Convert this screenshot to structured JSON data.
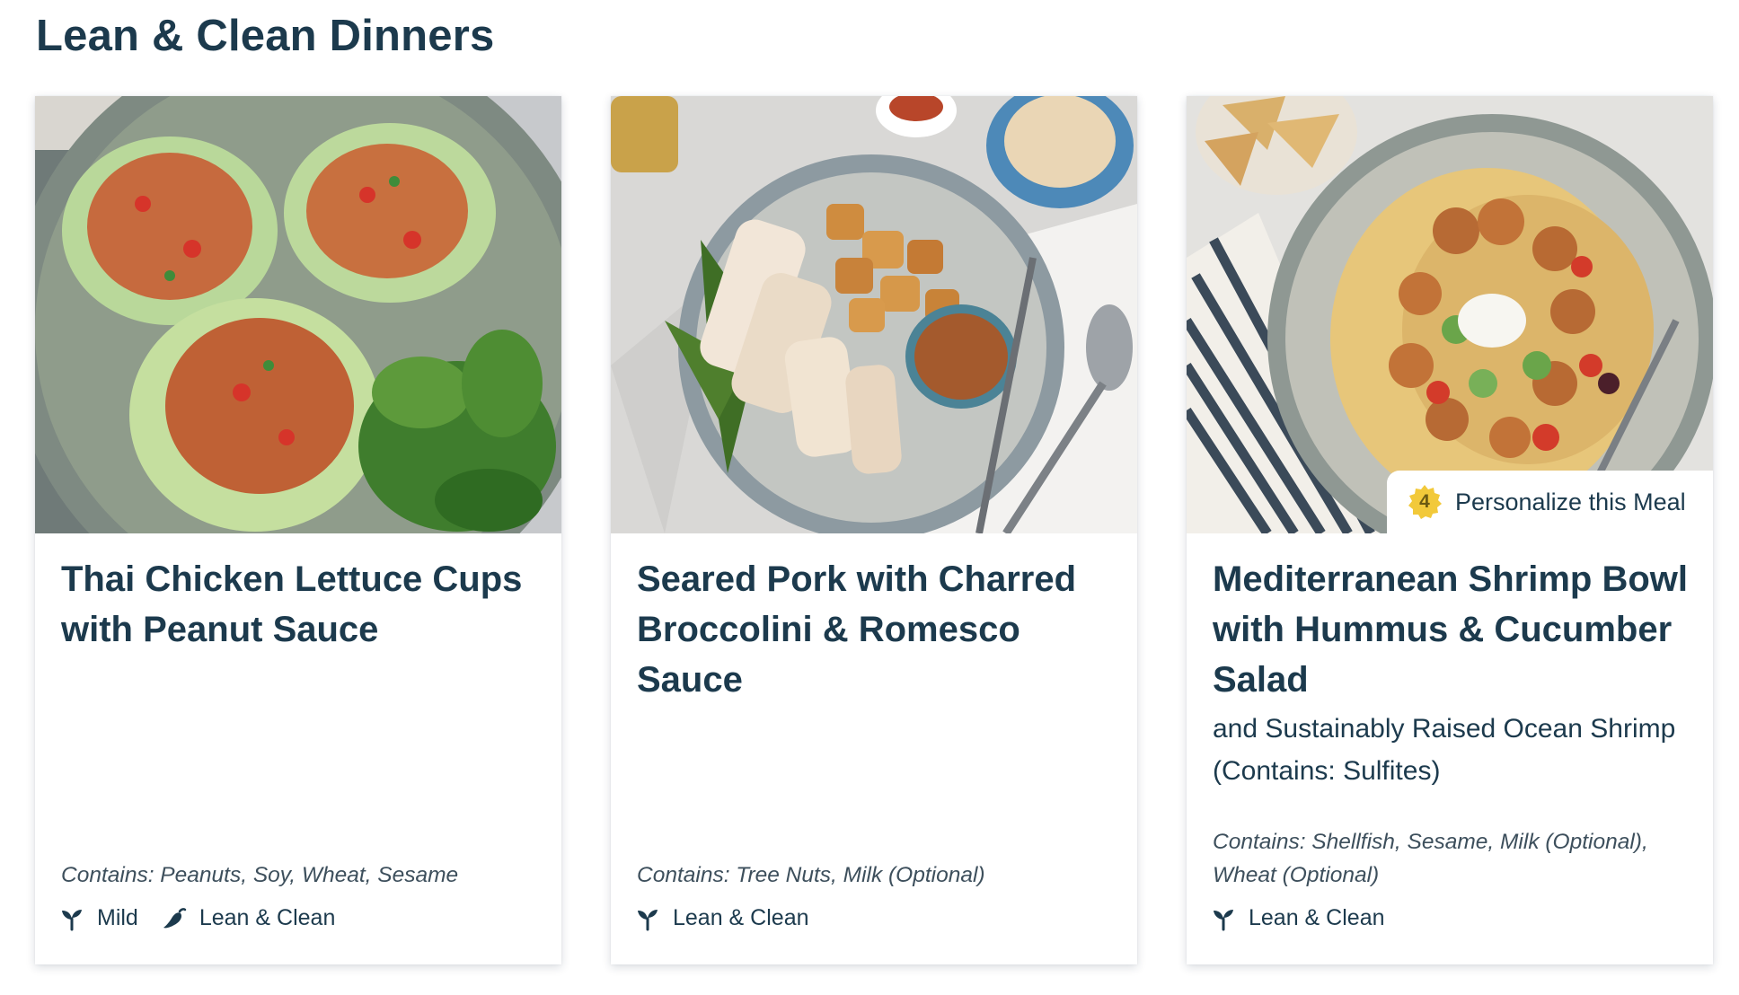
{
  "section": {
    "title": "Lean & Clean Dinners"
  },
  "cards": [
    {
      "image_alt": "Thai chicken lettuce cups on a plate with fresh herbs",
      "title": "Thai Chicken Lettuce Cups with Peanut Sauce",
      "subtitle": "",
      "allergens": "Contains: Peanuts, Soy, Wheat, Sesame",
      "tags": [
        {
          "label": "Mild",
          "icon": "sprout-icon"
        },
        {
          "label": "Lean & Clean",
          "icon": "chili-pepper-icon"
        }
      ]
    },
    {
      "image_alt": "Seared pork slices with charred broccolini, roasted potatoes and romesco sauce",
      "title": "Seared Pork with Charred Broccolini & Romesco Sauce",
      "subtitle": "",
      "allergens": "Contains: Tree Nuts, Milk (Optional)",
      "tags": [
        {
          "label": "Lean & Clean",
          "icon": "sprout-icon"
        }
      ]
    },
    {
      "image_alt": "Mediterranean shrimp bowl over hummus with cucumber salad",
      "title": "Mediterranean Shrimp Bowl with Hummus & Cucumber Salad",
      "subtitle": "and Sustainably Raised Ocean Shrimp (Contains: Sulfites)",
      "allergens": "Contains: Shellfish, Sesame, Milk (Optional), Wheat (Optional)",
      "tags": [
        {
          "label": "Lean & Clean",
          "icon": "sprout-icon"
        }
      ],
      "personalize": {
        "count": "4",
        "label": "Personalize this Meal",
        "icon": "badge-medal-icon"
      }
    }
  ],
  "colors": {
    "text_primary": "#1c3a4d",
    "text_muted": "#3d4f5c",
    "badge_gold": "#f2c93a"
  }
}
